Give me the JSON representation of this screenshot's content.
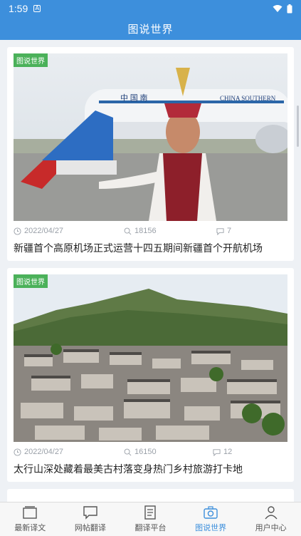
{
  "status_bar": {
    "time": "1:59",
    "badge": "A"
  },
  "header": {
    "title": "图说世界"
  },
  "articles": [
    {
      "tag": "图说世界",
      "date": "2022/04/27",
      "views": "18156",
      "comments": "7",
      "title": "新疆首个高原机场正式运营十四五期间新疆首个开航机场"
    },
    {
      "tag": "图说世界",
      "date": "2022/04/27",
      "views": "16150",
      "comments": "12",
      "title": "太行山深处藏着最美古村落变身热门乡村旅游打卡地"
    }
  ],
  "bottom_nav": [
    {
      "label": "最新译文",
      "icon": "folder-icon"
    },
    {
      "label": "网帖翻译",
      "icon": "chat-icon"
    },
    {
      "label": "翻译平台",
      "icon": "document-icon"
    },
    {
      "label": "图说世界",
      "icon": "camera-icon",
      "active": true
    },
    {
      "label": "用户中心",
      "icon": "user-icon"
    }
  ],
  "colors": {
    "primary": "#3d8fdc",
    "tag": "#4bb15a"
  }
}
